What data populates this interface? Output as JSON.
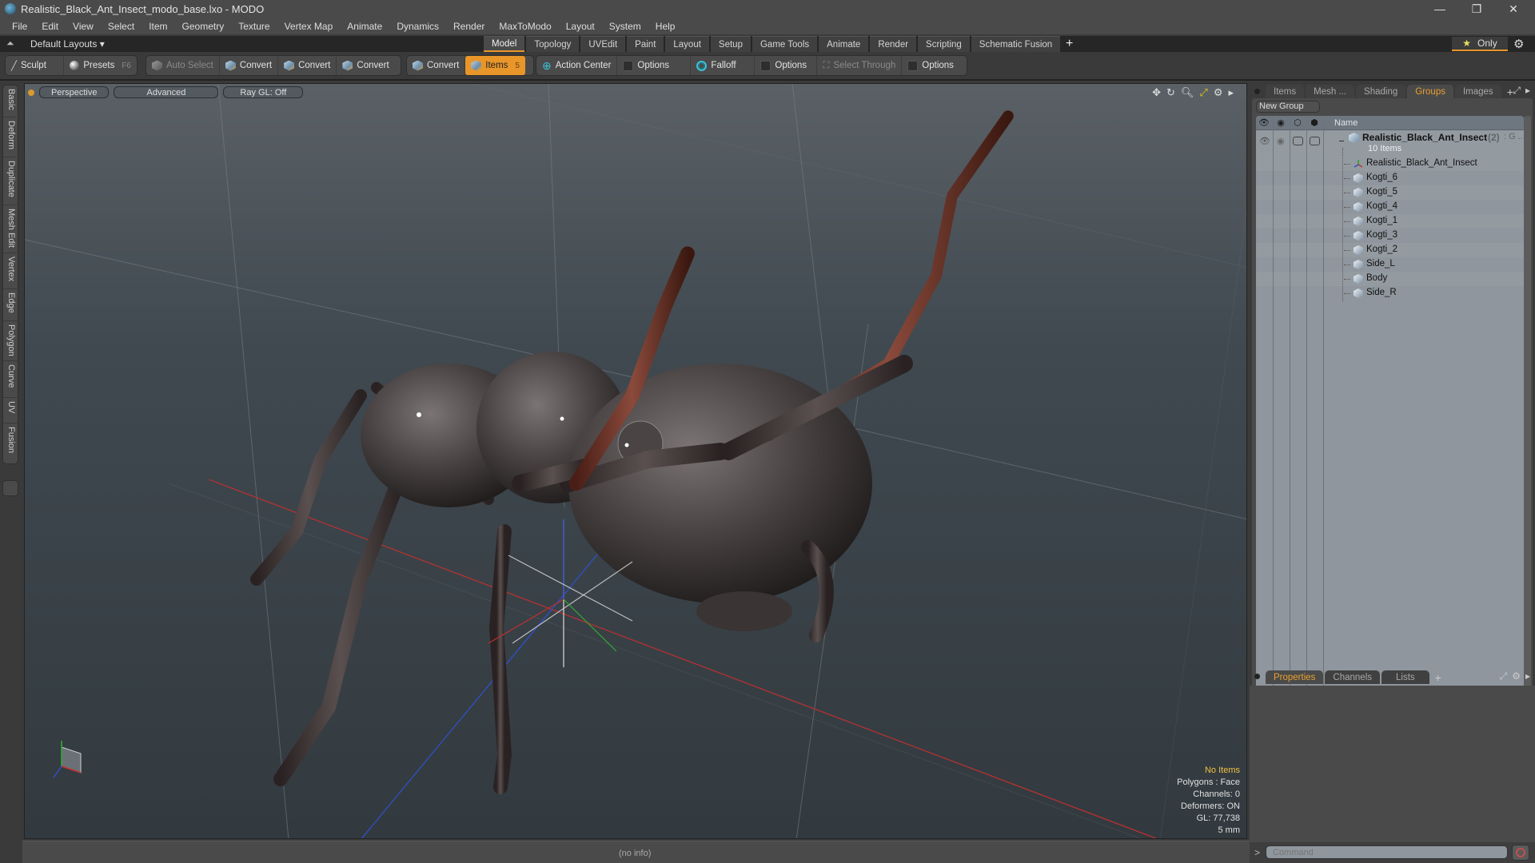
{
  "window": {
    "title": "Realistic_Black_Ant_Insect_modo_base.lxo - MODO",
    "minimize": "—",
    "restore": "❐",
    "close": "✕"
  },
  "menu": [
    "File",
    "Edit",
    "View",
    "Select",
    "Item",
    "Geometry",
    "Texture",
    "Vertex Map",
    "Animate",
    "Dynamics",
    "Render",
    "MaxToModo",
    "Layout",
    "System",
    "Help"
  ],
  "layout_row": {
    "layouts_label": "Default Layouts ▾",
    "mode_tabs": [
      "Model",
      "Topology",
      "UVEdit",
      "Paint",
      "Layout",
      "Setup",
      "Game Tools",
      "Animate",
      "Render",
      "Scripting",
      "Schematic Fusion"
    ],
    "active_mode": "Model",
    "add_tab": "+",
    "only_label": "Only",
    "only_star": "★"
  },
  "toolbar": {
    "sculpt": "Sculpt",
    "presets": "Presets",
    "presets_hint": "F6",
    "auto_select": "Auto Select",
    "convert1": "Convert",
    "convert2": "Convert",
    "convert3": "Convert",
    "convert4": "Convert",
    "items": "Items",
    "items_hint": "5",
    "action_center": "Action Center",
    "options1": "Options",
    "falloff": "Falloff",
    "options2": "Options",
    "select_through": "Select Through",
    "options3": "Options"
  },
  "left_tabs": [
    "Basic",
    "Deform",
    "Duplicate",
    "Mesh Edit",
    "Vertex",
    "Edge",
    "Polygon",
    "Curve",
    "UV",
    "Fusion"
  ],
  "viewport": {
    "view_mode": "Perspective",
    "shading": "Advanced",
    "raygl": "Ray GL: Off",
    "info": {
      "selection": "No Items",
      "polygons": "Polygons : Face",
      "channels": "Channels: 0",
      "deformers": "Deformers: ON",
      "gl": "GL: 77,738",
      "scale": "5 mm"
    },
    "colors": {
      "axis_x": "#c03030",
      "axis_y": "#30b030",
      "axis_z": "#3050d0",
      "accent": "#e8962a"
    }
  },
  "status": {
    "text": "(no info)"
  },
  "right_panel": {
    "top_tabs": [
      "Items",
      "Mesh ...",
      "Shading",
      "Groups",
      "Images"
    ],
    "active_top_tab": "Groups",
    "new_group": "New Group",
    "name_header": "Name",
    "group": {
      "name": "Realistic_Black_Ant_Insect",
      "count": "(2)",
      "suffix": ": G ...",
      "items_count": "10 Items"
    },
    "items": [
      {
        "name": "Realistic_Black_Ant_Insect",
        "type": "locator"
      },
      {
        "name": "Kogti_6",
        "type": "mesh"
      },
      {
        "name": "Kogti_5",
        "type": "mesh"
      },
      {
        "name": "Kogti_4",
        "type": "mesh"
      },
      {
        "name": "Kogti_1",
        "type": "mesh"
      },
      {
        "name": "Kogti_3",
        "type": "mesh"
      },
      {
        "name": "Kogti_2",
        "type": "mesh"
      },
      {
        "name": "Side_L",
        "type": "mesh"
      },
      {
        "name": "Body",
        "type": "mesh"
      },
      {
        "name": "Side_R",
        "type": "mesh"
      }
    ],
    "bottom_tabs": [
      "Properties",
      "Channels",
      "Lists"
    ],
    "active_bottom_tab": "Properties",
    "command_placeholder": "Command",
    "command_prompt": ">"
  }
}
